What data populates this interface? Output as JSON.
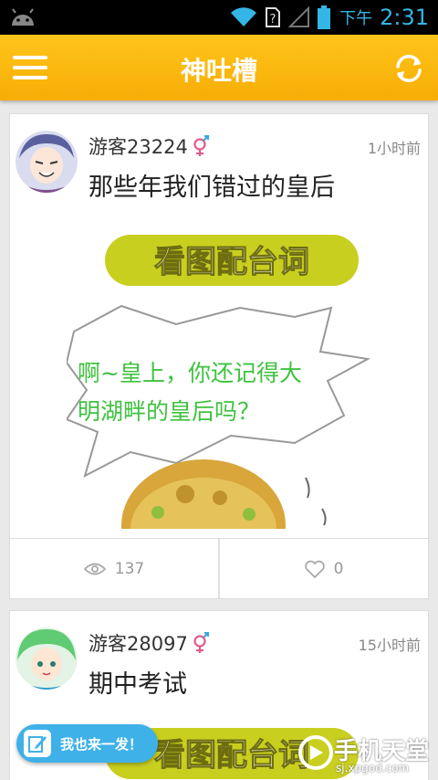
{
  "status_bar": {
    "ampm": "下午",
    "clock": "2:31",
    "icons": [
      "android-icon",
      "wifi-icon",
      "no-sim-icon",
      "signal-icon",
      "battery-icon"
    ]
  },
  "app_bar": {
    "title": "神吐槽",
    "menu_icon": "hamburger-menu-icon",
    "refresh_icon": "refresh-icon"
  },
  "posts": [
    {
      "username": "游客23224",
      "gender_icon": "gender-icon",
      "time": "1小时前",
      "title": "那些年我们错过的皇后",
      "image": {
        "banner": "看图配台词",
        "bubble_line1": "啊~皇上，你还记得大",
        "bubble_line2": "明湖畔的皇后吗？"
      },
      "views": "137",
      "likes": "0"
    },
    {
      "username": "游客28097",
      "gender_icon": "gender-icon",
      "time": "15小时前",
      "title": "期中考试",
      "image": {
        "banner": "看图配台词"
      }
    }
  ],
  "fab": {
    "label": "我也来一发！",
    "icon": "edit-icon"
  },
  "watermark": {
    "text": "手机天堂",
    "url": "sj.xpgod.com"
  },
  "colors": {
    "app_bar": "#f9b50c",
    "fab": "#3fb1e9",
    "status_text": "#33b5e5",
    "banner_green": "#c9cf1f"
  }
}
